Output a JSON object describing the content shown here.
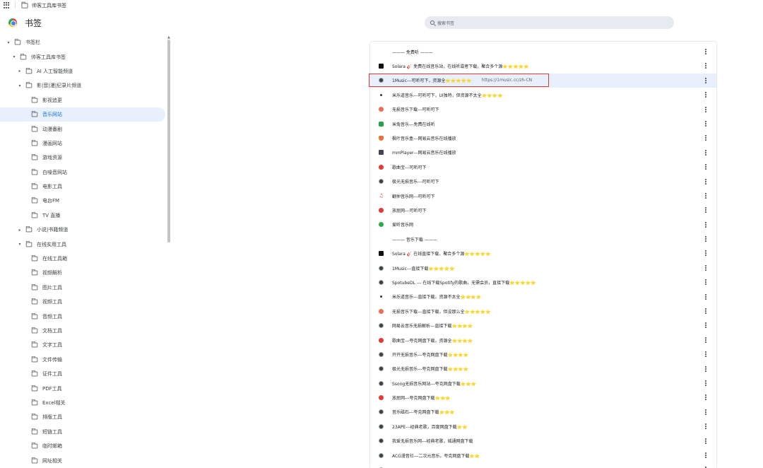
{
  "topbar": {
    "folder_label": "帅客工具库书签"
  },
  "header": {
    "title": "书签",
    "search_placeholder": "搜索书签"
  },
  "sidebar": {
    "items": [
      {
        "label": "书签栏",
        "depth": 0,
        "arrow": "▾",
        "selected": false
      },
      {
        "label": "帅客工具库书签",
        "depth": 1,
        "arrow": "▾",
        "selected": false
      },
      {
        "label": "AI 人工智能频道",
        "depth": 2,
        "arrow": "▸",
        "selected": false
      },
      {
        "label": "影|音|漫|纪录片频道",
        "depth": 2,
        "arrow": "▾",
        "selected": false
      },
      {
        "label": "影视追更",
        "depth": 3,
        "arrow": "",
        "selected": false
      },
      {
        "label": "音乐网站",
        "depth": 3,
        "arrow": "",
        "selected": true
      },
      {
        "label": "动漫番剧",
        "depth": 3,
        "arrow": "",
        "selected": false
      },
      {
        "label": "漫画网站",
        "depth": 3,
        "arrow": "",
        "selected": false
      },
      {
        "label": "游戏资源",
        "depth": 3,
        "arrow": "",
        "selected": false
      },
      {
        "label": "白噪音网站",
        "depth": 3,
        "arrow": "",
        "selected": false
      },
      {
        "label": "电影工具",
        "depth": 3,
        "arrow": "",
        "selected": false
      },
      {
        "label": "电台FM",
        "depth": 3,
        "arrow": "",
        "selected": false
      },
      {
        "label": "TV 直播",
        "depth": 3,
        "arrow": "",
        "selected": false
      },
      {
        "label": "小说|书籍频道",
        "depth": 2,
        "arrow": "▸",
        "selected": false
      },
      {
        "label": "在线实用工具",
        "depth": 2,
        "arrow": "▾",
        "selected": false
      },
      {
        "label": "在线工具箱",
        "depth": 3,
        "arrow": "",
        "selected": false
      },
      {
        "label": "视频解析",
        "depth": 3,
        "arrow": "",
        "selected": false
      },
      {
        "label": "图片工具",
        "depth": 3,
        "arrow": "",
        "selected": false
      },
      {
        "label": "视频工具",
        "depth": 3,
        "arrow": "",
        "selected": false
      },
      {
        "label": "音频工具",
        "depth": 3,
        "arrow": "",
        "selected": false
      },
      {
        "label": "文档工具",
        "depth": 3,
        "arrow": "",
        "selected": false
      },
      {
        "label": "文字工具",
        "depth": 3,
        "arrow": "",
        "selected": false
      },
      {
        "label": "文件传输",
        "depth": 3,
        "arrow": "",
        "selected": false
      },
      {
        "label": "证件工具",
        "depth": 3,
        "arrow": "",
        "selected": false
      },
      {
        "label": "PDF工具",
        "depth": 3,
        "arrow": "",
        "selected": false
      },
      {
        "label": "Excel相关",
        "depth": 3,
        "arrow": "",
        "selected": false
      },
      {
        "label": "排版工具",
        "depth": 3,
        "arrow": "",
        "selected": false
      },
      {
        "label": "短链工具",
        "depth": 3,
        "arrow": "",
        "selected": false
      },
      {
        "label": "临时邮箱",
        "depth": 3,
        "arrow": "",
        "selected": false
      },
      {
        "label": "网址相关",
        "depth": 3,
        "arrow": "",
        "selected": false
      }
    ]
  },
  "bookmarks": [
    {
      "kind": "separator",
      "title": "——— 免费听 ———"
    },
    {
      "kind": "item",
      "icon": "black",
      "title": "Solara 🎸 免费在线音乐站，在线听或者下载，聚合多个源⭐⭐⭐⭐⭐",
      "url": ""
    },
    {
      "kind": "item",
      "icon": "globe",
      "title": "1Music---可听可下，资源全⭐⭐⭐⭐⭐",
      "url": "https://1music.cc/zh-CN",
      "highlighted": true
    },
    {
      "kind": "item",
      "icon": "small",
      "title": "米乐道音乐---可听可下，UI独特，但资源不太全⭐⭐⭐⭐",
      "url": ""
    },
    {
      "kind": "item",
      "icon": "orange",
      "title": "无损音乐下载---可听可下",
      "url": ""
    },
    {
      "kind": "item",
      "icon": "green",
      "title": "米兔音乐---免费在线听",
      "url": ""
    },
    {
      "kind": "item",
      "icon": "maple",
      "title": "枫叶音乐盒---网易云音乐在线播放",
      "url": ""
    },
    {
      "kind": "item",
      "icon": "img",
      "title": "mmPlayer---网易云音乐在线播放",
      "url": ""
    },
    {
      "kind": "item",
      "icon": "red",
      "title": "歌曲宝---可听可下",
      "url": ""
    },
    {
      "kind": "item",
      "icon": "globe",
      "title": "极光无损音乐---可听可下",
      "url": ""
    },
    {
      "kind": "item",
      "icon": "note",
      "title": "翻仲音乐网---可听可下",
      "url": ""
    },
    {
      "kind": "item",
      "icon": "red",
      "title": "放屁网---可听可下",
      "url": ""
    },
    {
      "kind": "item",
      "icon": "green-c",
      "title": "爱听音乐网",
      "url": ""
    },
    {
      "kind": "separator",
      "title": "——— 音乐下载 ———"
    },
    {
      "kind": "item",
      "icon": "black",
      "title": "Solara 🎸 在线直接下载，聚合多个源⭐⭐⭐⭐⭐",
      "url": ""
    },
    {
      "kind": "item",
      "icon": "globe",
      "title": "1Music---直接下载⭐⭐⭐⭐⭐",
      "url": ""
    },
    {
      "kind": "item",
      "icon": "globe",
      "title": "SpotubeDL --- 在线下载Spotify的歌曲，无需会员，直接下载⭐⭐⭐⭐⭐",
      "url": ""
    },
    {
      "kind": "item",
      "icon": "small",
      "title": "米乐道音乐---直接下载，资源不太全⭐⭐⭐⭐",
      "url": ""
    },
    {
      "kind": "item",
      "icon": "orange",
      "title": "无损音乐下载---直接下载，但没那么全⭐⭐⭐⭐⭐",
      "url": ""
    },
    {
      "kind": "item",
      "icon": "globe",
      "title": "网易云音乐无损解析---直接下载⭐⭐⭐⭐",
      "url": ""
    },
    {
      "kind": "item",
      "icon": "red",
      "title": "歌曲宝---夸克网盘下载，资源全⭐⭐⭐⭐",
      "url": ""
    },
    {
      "kind": "item",
      "icon": "globe",
      "title": "开开无损音乐---夸克网盘下载⭐⭐⭐⭐",
      "url": ""
    },
    {
      "kind": "item",
      "icon": "globe",
      "title": "极光无损音乐---夸克网盘下载⭐⭐⭐⭐",
      "url": ""
    },
    {
      "kind": "item",
      "icon": "globe",
      "title": "Ssong无损音乐网站---夸克网盘下载⭐⭐⭐",
      "url": ""
    },
    {
      "kind": "item",
      "icon": "red",
      "title": "放屁网---夸克网盘下载⭐⭐⭐",
      "url": ""
    },
    {
      "kind": "item",
      "icon": "globe",
      "title": "音乐磁石---夸克网盘下载⭐⭐⭐",
      "url": ""
    },
    {
      "kind": "item",
      "icon": "globe",
      "title": "23APE---经典老歌，百度网盘下载⭐⭐",
      "url": ""
    },
    {
      "kind": "item",
      "icon": "globe",
      "title": "我爱无损音乐网---经典老歌，城通网盘下载",
      "url": ""
    },
    {
      "kind": "item",
      "icon": "globe",
      "title": "ACG漫音社---二次元音乐，夸克网盘下载⭐⭐",
      "url": ""
    },
    {
      "kind": "item",
      "icon": "globe",
      "title": "",
      "url": ""
    }
  ]
}
